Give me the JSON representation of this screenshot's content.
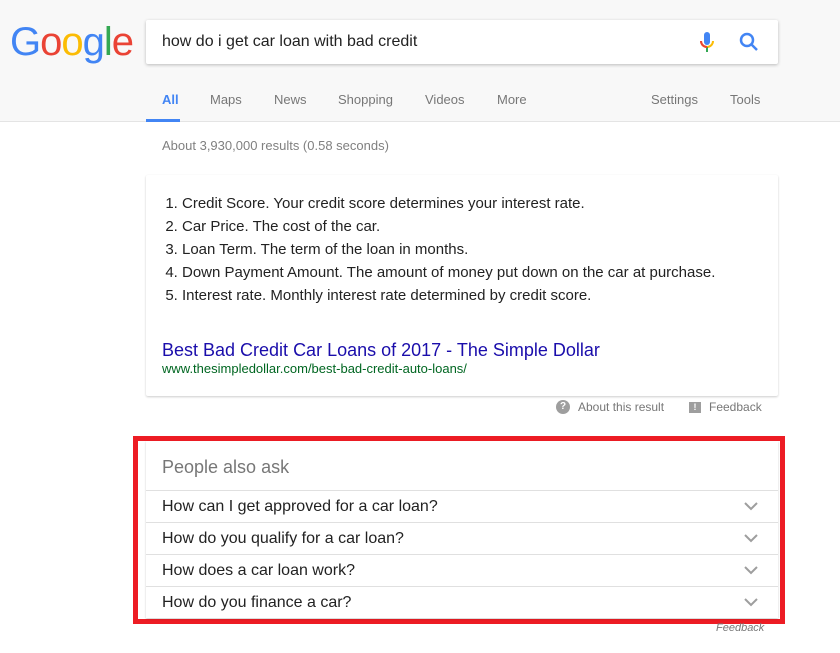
{
  "logo": "Google",
  "search": {
    "query": "how do i get car loan with bad credit"
  },
  "tabs": [
    {
      "label": "All",
      "active": true
    },
    {
      "label": "Maps"
    },
    {
      "label": "News"
    },
    {
      "label": "Shopping"
    },
    {
      "label": "Videos"
    },
    {
      "label": "More"
    }
  ],
  "tools": {
    "settings": "Settings",
    "tools": "Tools"
  },
  "stats": "About 3,930,000 results (0.58 seconds)",
  "snippet": {
    "items": [
      "Credit Score. Your credit score determines your interest rate.",
      "Car Price. The cost of the car.",
      "Loan Term. The term of the loan in months.",
      "Down Payment Amount. The amount of money put down on the car at purchase.",
      "Interest rate. Monthly interest rate determined by credit score."
    ],
    "link": "Best Bad Credit Car Loans of 2017 - The Simple Dollar",
    "url": "www.thesimpledollar.com/best-bad-credit-auto-loans/"
  },
  "meta": {
    "about": "About this result",
    "feedback": "Feedback"
  },
  "paa": {
    "title": "People also ask",
    "questions": [
      "How can I get approved for a car loan?",
      "How do you qualify for a car loan?",
      "How does a car loan work?",
      "How do you finance a car?"
    ],
    "feedback": "Feedback"
  },
  "colors": {
    "accent": "#4285f4",
    "link": "#1a0dab",
    "url": "#006621",
    "highlight": "#ed1c24"
  }
}
